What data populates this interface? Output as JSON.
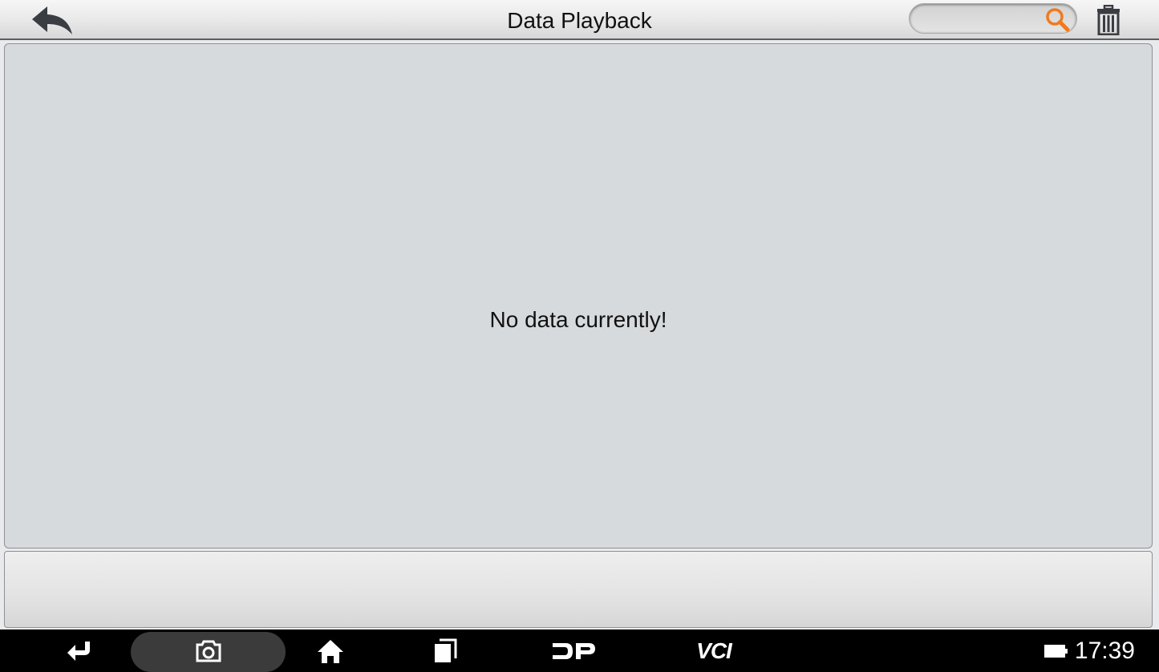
{
  "header": {
    "title": "Data Playback",
    "back_icon": "back-arrow-icon",
    "search": {
      "value": "",
      "placeholder": "",
      "icon": "search-icon",
      "icon_color": "#f07a1e"
    },
    "delete_icon": "trash-icon"
  },
  "main": {
    "empty_message": "No data currently!"
  },
  "navbar": {
    "items": [
      {
        "icon": "back-icon"
      },
      {
        "icon": "camera-icon"
      },
      {
        "icon": "home-icon"
      },
      {
        "icon": "recents-icon"
      },
      {
        "label": "DP"
      },
      {
        "label": "VCI"
      }
    ],
    "battery_icon": "battery-icon",
    "time": "17:39"
  }
}
